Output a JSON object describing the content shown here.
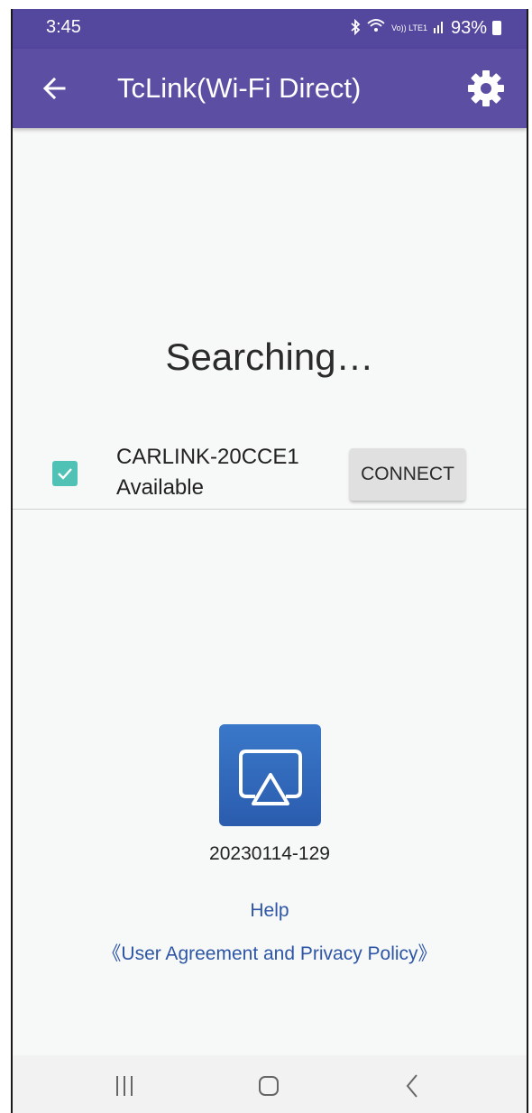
{
  "status_bar": {
    "time": "3:45",
    "battery_percent": "93%",
    "signal_text": "Vo)) LTE1",
    "icons": [
      "bluetooth-icon",
      "wifi-icon",
      "lte-icon",
      "signal-icon",
      "battery-icon"
    ]
  },
  "app_bar": {
    "title": "TcLink(Wi-Fi Direct)",
    "back_icon": "arrow-left-icon",
    "settings_icon": "gear-icon",
    "color": "#5c4ea3"
  },
  "main": {
    "searching_text": "Searching…",
    "device": {
      "name": "CARLINK-20CCE1",
      "status": "Available",
      "checked": true,
      "connect_label": "CONNECT"
    },
    "checkbox_color": "#4fc2b5"
  },
  "footer": {
    "logo_icon": "screen-mirror-icon",
    "version": "20230114-129",
    "help_label": "Help",
    "policy_label": "《User Agreement and Privacy Policy》",
    "link_color": "#2e56a6"
  },
  "nav_bar": {
    "recents_icon": "recents-icon",
    "home_icon": "home-icon",
    "back_icon": "back-icon"
  }
}
